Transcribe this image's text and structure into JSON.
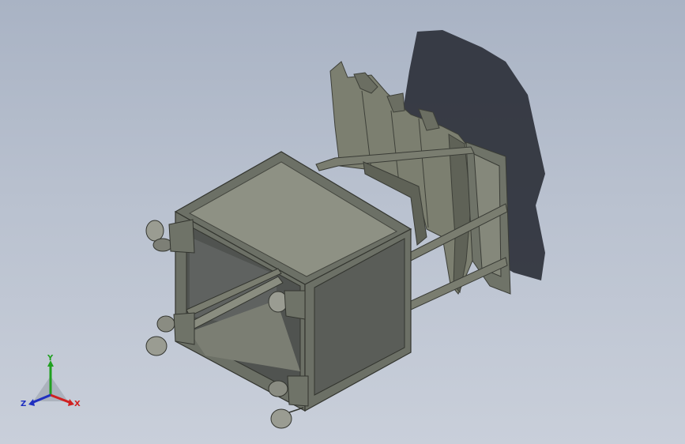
{
  "viewport": {
    "background_top": "#a9b3c4",
    "background_bottom": "#c9cfda"
  },
  "model": {
    "frame_color": "#6f7368",
    "panel_color": "#8a8d80",
    "panel_dark": "#5d605a",
    "shadow_color": "#2a2e36"
  },
  "triad": {
    "x_label": "X",
    "y_label": "Y",
    "z_label": "Z",
    "x_color": "#d02020",
    "y_color": "#20a020",
    "z_color": "#2030c0"
  }
}
